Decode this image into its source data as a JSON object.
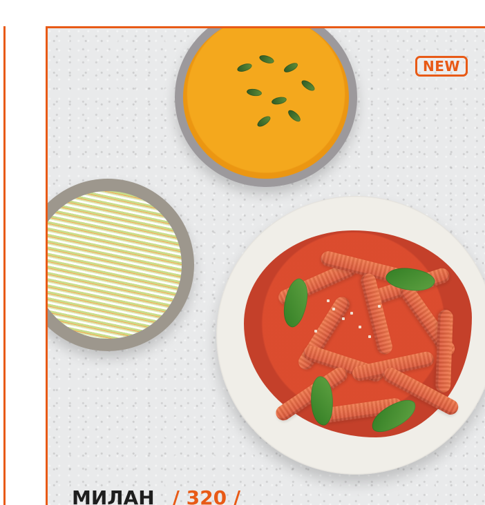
{
  "colors": {
    "accent": "#e85a16",
    "text": "#1e1e1e"
  },
  "badge": {
    "text": "NEW"
  },
  "combo": {
    "name": "МИЛАН",
    "price_display": "/ 320 /"
  },
  "images": {
    "soup_bowl": "pumpkin-soup-bowl",
    "cabbage_bowl": "cabbage-salad-bowl",
    "pasta_plate": "penne-tomato-plate"
  }
}
